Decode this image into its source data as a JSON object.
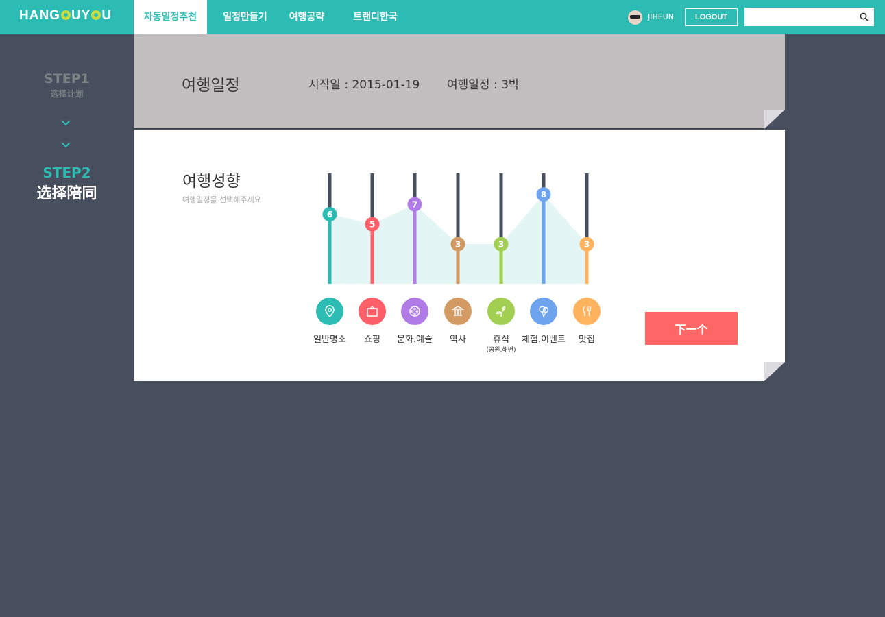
{
  "header": {
    "logo": "HANGOUYOU",
    "logo_parts": [
      "HANG",
      "UY",
      "U"
    ],
    "nav": [
      {
        "label": "자동일정추천",
        "active": true
      },
      {
        "label": "일정만들기"
      },
      {
        "label": "여행공략"
      },
      {
        "label": "트랜디한국"
      }
    ],
    "user": "JIHEUN",
    "logout": "LOGOUT",
    "search_placeholder": ""
  },
  "sidebar": {
    "step1": {
      "title": "STEP1",
      "sub": "选择计划"
    },
    "step2": {
      "title": "STEP2",
      "sub": "选择陪同"
    }
  },
  "summary": {
    "title": "여행일정",
    "start": "시작일 : 2015-01-19",
    "duration": "여행일정 : 3박"
  },
  "prefs": {
    "title": "여행성향",
    "subtitle": "여행일정을 선택해주세요",
    "next": "下一个",
    "items": [
      {
        "label": "일반명소",
        "value": 6,
        "color": "#2dbcb3",
        "icon": "map-pin-icon"
      },
      {
        "label": "쇼핑",
        "value": 5,
        "color": "#ff5f69",
        "icon": "shopping-bag-icon"
      },
      {
        "label": "문화.예술",
        "value": 7,
        "color": "#b07be6",
        "icon": "film-reel-icon"
      },
      {
        "label": "역사",
        "value": 3,
        "color": "#d39b63",
        "icon": "museum-icon"
      },
      {
        "label": "휴식",
        "sub": "(공원.해변)",
        "value": 3,
        "color": "#a2cf52",
        "icon": "leaf-icon"
      },
      {
        "label": "체험.이벤트",
        "value": 8,
        "color": "#6ea4ee",
        "icon": "balloon-icon"
      },
      {
        "label": "맛집",
        "value": 3,
        "color": "#ffb35e",
        "icon": "fork-knife-icon"
      }
    ]
  }
}
